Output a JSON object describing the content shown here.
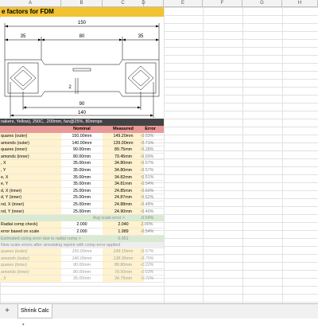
{
  "columns": [
    "A",
    "B",
    "C",
    "D",
    "E",
    "F",
    "G",
    "H"
  ],
  "title": "e factors for FDM",
  "dims": {
    "overall_top": "150",
    "left": "35",
    "mid": "80",
    "right": "35",
    "small": "2",
    "bottom_mid": "90",
    "bottom_total": "140"
  },
  "conditions": "nakers, Yellow), 250C, .200mm, fan@25%, 80mmps",
  "headers": {
    "nominal": "Nominal",
    "measured": "Measured",
    "error": "Error"
  },
  "rows": [
    {
      "label": "quares (outer)",
      "nominal": "150.00mm",
      "measured": "149.20mm",
      "error": "-0.53%"
    },
    {
      "label": "amonds (outer)",
      "nominal": "140.00mm",
      "measured": "139.00mm",
      "error": "-0.71%"
    },
    {
      "label": "quares (inner)",
      "nominal": "90.00mm",
      "measured": "89.75mm",
      "error": "-0.28%"
    },
    {
      "label": "amonds (inner)",
      "nominal": "80.00mm",
      "measured": "79.45mm",
      "error": "-0.69%"
    },
    {
      "label": ", X",
      "nominal": "35.00mm",
      "measured": "34.80mm",
      "error": "-0.57%"
    },
    {
      "label": ", Y",
      "nominal": "35.00mm",
      "measured": "34.80mm",
      "error": "-0.57%"
    },
    {
      "label": "e, X",
      "nominal": "35.00mm",
      "measured": "34.82mm",
      "error": "-0.51%"
    },
    {
      "label": "e, Y",
      "nominal": "35.00mm",
      "measured": "34.81mm",
      "error": "-0.54%"
    },
    {
      "label": "d, X (inner)",
      "nominal": "25.00mm",
      "measured": "24.85mm",
      "error": "-0.60%"
    },
    {
      "label": "d, Y (inner)",
      "nominal": "25.00mm",
      "measured": "24.87mm",
      "error": "-0.52%"
    },
    {
      "label": "nd, X (inner)",
      "nominal": "25.00mm",
      "measured": "24.88mm",
      "error": "-0.48%"
    },
    {
      "label": "nd, Y (inner)",
      "nominal": "25.00mm",
      "measured": "24.90mm",
      "error": "-0.40%"
    }
  ],
  "avg": {
    "label": "Avg scale error >",
    "value": "-0.54%"
  },
  "radial": {
    "label": "Radial comp check)",
    "nominal": "2.000",
    "measured": "2.040",
    "error": "2.00%"
  },
  "onscale": {
    "label": "error based on scale",
    "nominal": "2.000",
    "measured": "1.989",
    "error": "-0.54%"
  },
  "est": {
    "label": "Estimated sizing error due to radial comp >",
    "value": "0.051"
  },
  "note": "New scale errors after simulating reprint with comp error applied",
  "rows2": [
    {
      "label": "quares (outer)",
      "nominal": "150.00mm",
      "measured": "149.15mm",
      "error": "-0.57%"
    },
    {
      "label": "amonds (outer)",
      "nominal": "140.00mm",
      "measured": "138.95mm",
      "error": "-0.75%"
    },
    {
      "label": "quares (inner)",
      "nominal": "90.00mm",
      "measured": "89.80mm",
      "error": "-0.22%"
    },
    {
      "label": "amonds (inner)",
      "nominal": "80.00mm",
      "measured": "79.50mm",
      "error": "-0.63%"
    },
    {
      "label": ", X",
      "nominal": "35.00mm",
      "measured": "34.75mm",
      "error": "-0.72%"
    }
  ],
  "sheet_tab": "Shrink Calc",
  "colors": {
    "title_bg": "#f1c232",
    "header_bg": "#ea9999",
    "cond_bg": "#434343",
    "yellow_cell": "#fff2cc",
    "avg_bg": "#d9ead3"
  }
}
